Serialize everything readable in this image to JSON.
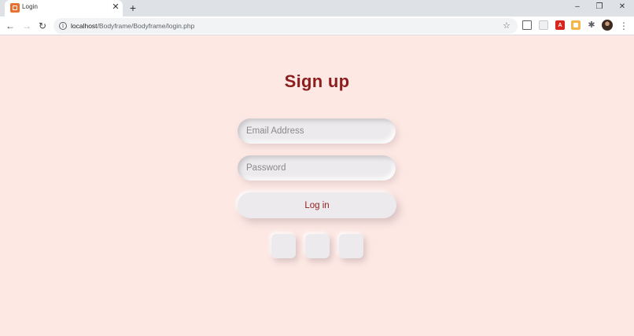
{
  "browser": {
    "tab": {
      "title": "Login",
      "close_label": "✕"
    },
    "new_tab_label": "+",
    "window_controls": {
      "minimize": "–",
      "restore": "❐",
      "close": "✕"
    },
    "url": {
      "host": "localhost",
      "path": "/Bodyframe/Bodyframe/login.php"
    },
    "extensions": {
      "pdf_label": "A"
    }
  },
  "page": {
    "title": "Sign up",
    "email": {
      "placeholder": "Email Address",
      "value": ""
    },
    "password": {
      "placeholder": "Password",
      "value": ""
    },
    "login_button": "Log in"
  },
  "colors": {
    "page_background": "#fde8e4",
    "title_color": "#8c1e1e",
    "button_surface": "#eceaec"
  }
}
